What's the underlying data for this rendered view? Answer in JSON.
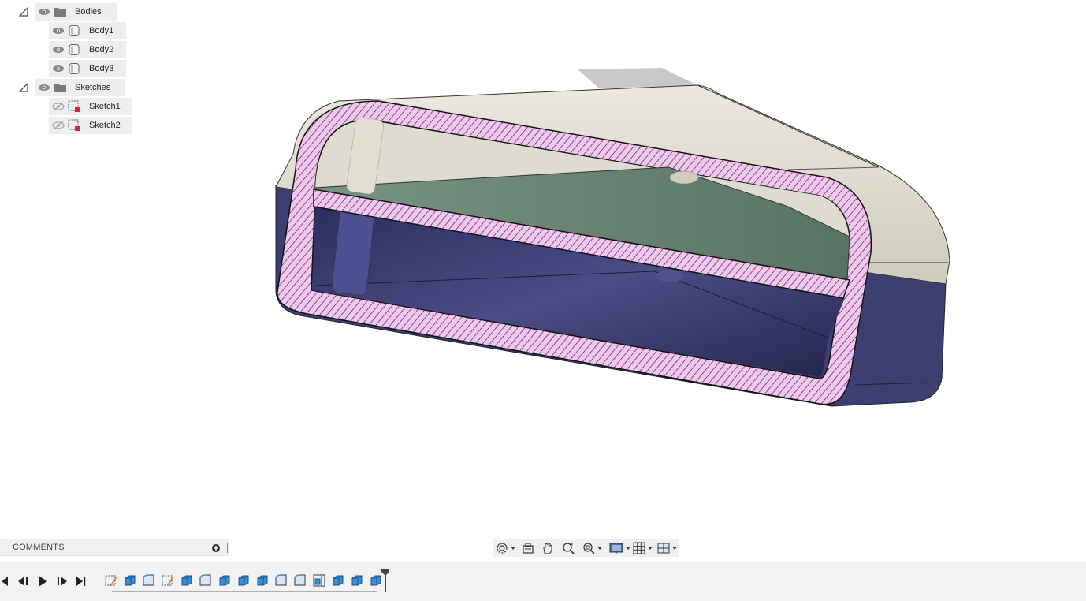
{
  "browser": {
    "bodies_folder": {
      "label": "Bodies"
    },
    "bodies": [
      {
        "label": "Body1"
      },
      {
        "label": "Body2"
      },
      {
        "label": "Body3"
      }
    ],
    "sketches_folder": {
      "label": "Sketches"
    },
    "sketches": [
      {
        "label": "Sketch1"
      },
      {
        "label": "Sketch2"
      }
    ]
  },
  "comments": {
    "label": "COMMENTS"
  },
  "nav_toolbar": {
    "tools": [
      "orbit-icon",
      "look-at-icon",
      "pan-icon",
      "zoom-icon",
      "fit-icon",
      "display-settings-icon",
      "grid-settings-icon",
      "viewports-icon"
    ]
  },
  "timeline": {
    "controls": [
      "go-to-start-icon",
      "step-back-icon",
      "play-icon",
      "step-forward-icon",
      "go-to-end-icon"
    ],
    "features": [
      "sketch",
      "extrude",
      "fillet",
      "sketch",
      "extrude",
      "fillet",
      "extrude",
      "extrude",
      "extrude",
      "fillet",
      "fillet",
      "split-body",
      "extrude",
      "extrude",
      "extrude"
    ]
  },
  "colors": {
    "section_fill": "#f6c6f3",
    "section_hatch": "#222222",
    "top_body": "#dedbd0",
    "bottom_body": "#3d3f70",
    "plate": "#6a8574",
    "panel_bg": "#eeeeee",
    "timeline_bg": "#f2f2f2",
    "feature_blue": "#3a8fd6"
  }
}
